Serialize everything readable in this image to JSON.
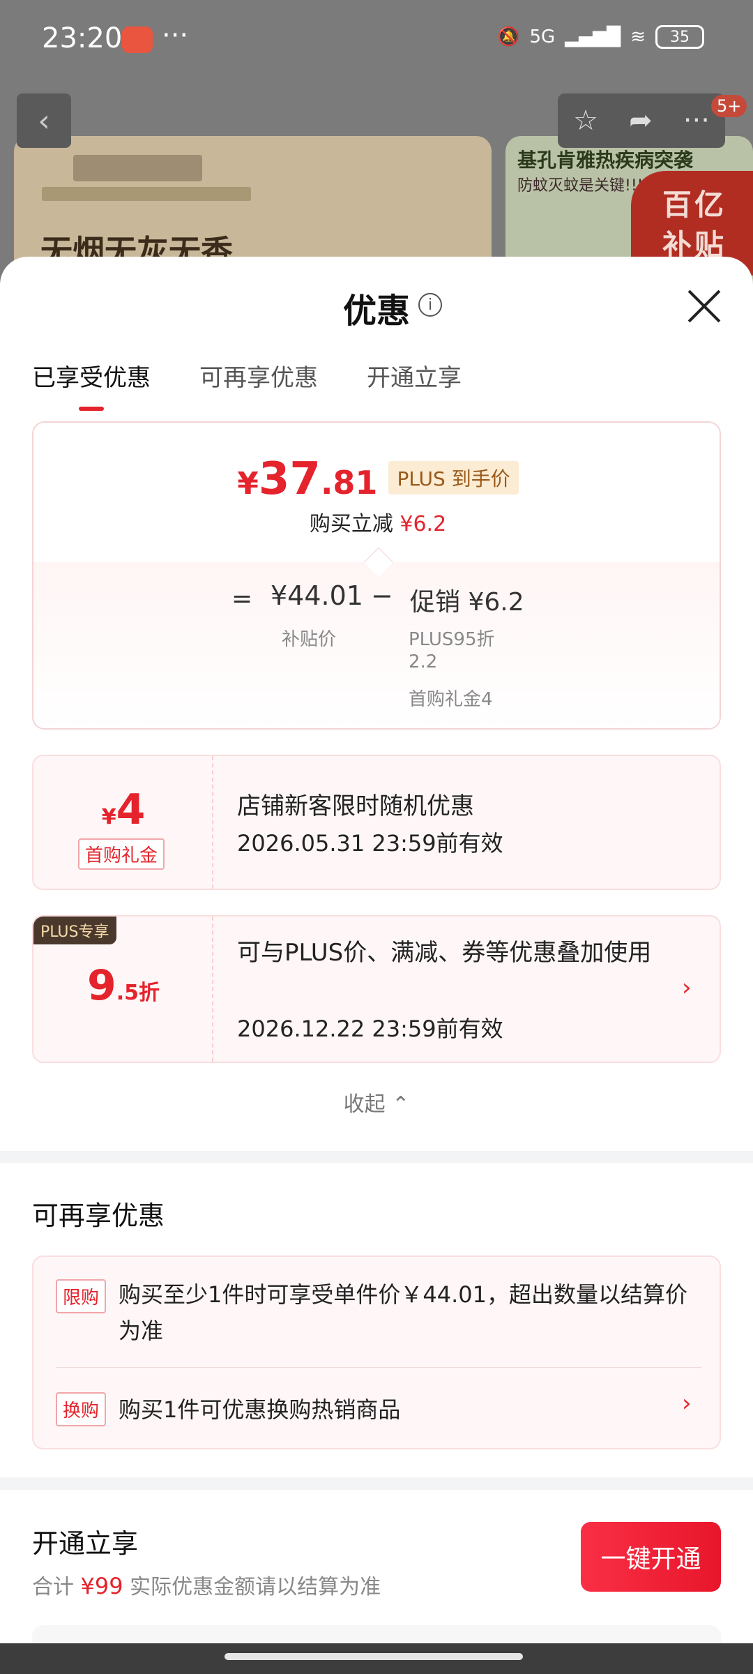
{
  "status_bar": {
    "time": "23:20",
    "dots": "···",
    "network": "5G",
    "battery": "35"
  },
  "background": {
    "headline": "无烟无灰无香",
    "right_title": "基孔肯雅热疾病突袭",
    "right_sub": "防蚊灭蚊是关键!!!",
    "tag_line1": "百亿",
    "tag_line2": "补贴",
    "badge": "5+"
  },
  "sheet": {
    "title": "优惠",
    "info_icon": "i",
    "tabs": [
      {
        "label": "已享受优惠"
      },
      {
        "label": "可再享优惠"
      },
      {
        "label": "开通立享"
      }
    ]
  },
  "price_card": {
    "yen": "¥",
    "int": "37",
    "dec": ".81",
    "plus_tag": "PLUS 到手价",
    "reduce_label": "购买立减",
    "reduce_value": "¥6.2",
    "eq": "=",
    "base": "¥44.01",
    "base_label": "补贴价",
    "minus": "−",
    "promo": "促销 ¥6.2",
    "promo_detail1": "PLUS95折",
    "promo_detail2": "2.2",
    "promo_detail3": "首购礼金4"
  },
  "coupons": [
    {
      "yen": "¥",
      "amount": "4",
      "tag": "首购礼金",
      "title": "店铺新客限时随机优惠",
      "date": "2026.05.31 23:59前有效"
    },
    {
      "label": "PLUS专享",
      "amount": "9",
      "unit": ".5折",
      "title": "可与PLUS价、满减、券等优惠叠加使用",
      "date": "2026.12.22 23:59前有效",
      "arrow": "›"
    }
  ],
  "collapse_label": "收起 ⌃",
  "more_offers": {
    "title": "可再享优惠",
    "rows": [
      {
        "tag": "限购",
        "text": "购买至少1件时可享受单件价￥44.01，超出数量以结算价为准"
      },
      {
        "tag": "换购",
        "text": "购买1件可优惠换购热销商品",
        "arrow": "›"
      }
    ]
  },
  "open_now": {
    "title": "开通立享",
    "total_label": "合计",
    "total_value": "¥99",
    "note": "实际优惠金额请以结算为准",
    "button": "一键开通"
  },
  "colors": {
    "accent": "#e4232c",
    "plus_brown": "#4a382c"
  }
}
